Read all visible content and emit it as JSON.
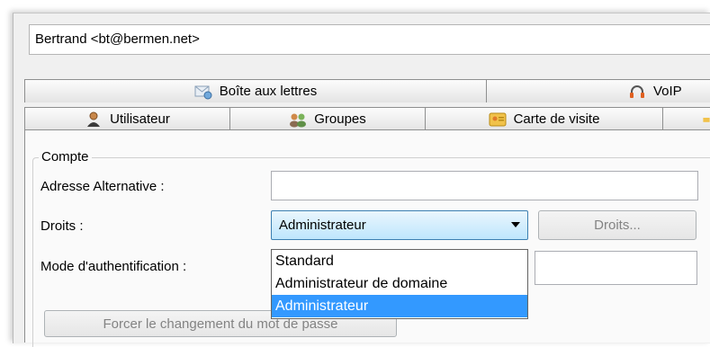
{
  "header": {
    "user": "Bertrand <bt@bermen.net>"
  },
  "tabs_top": [
    {
      "label": "Boîte aux lettres",
      "icon": "mailbox-icon"
    },
    {
      "label": "VoIP",
      "icon": "headset-icon"
    }
  ],
  "tabs_bottom": [
    {
      "label": "Utilisateur",
      "icon": "user-icon"
    },
    {
      "label": "Groupes",
      "icon": "groups-icon"
    },
    {
      "label": "Carte de visite",
      "icon": "business-card-icon"
    }
  ],
  "compte": {
    "group_title": "Compte",
    "alt_address_label": "Adresse Alternative :",
    "alt_address_value": "",
    "rights_label": "Droits :",
    "rights_selected": "Administrateur",
    "rights_button": "Droits...",
    "auth_label": "Mode d'authentification :",
    "auth_value": "",
    "force_pwd_button": "Forcer le changement du mot de passe"
  },
  "dropdown": {
    "options": [
      "Standard",
      "Administrateur de domaine",
      "Administrateur"
    ],
    "selected_index": 2
  },
  "colors": {
    "selection": "#3399ff",
    "combo_border": "#3c7fb1"
  }
}
